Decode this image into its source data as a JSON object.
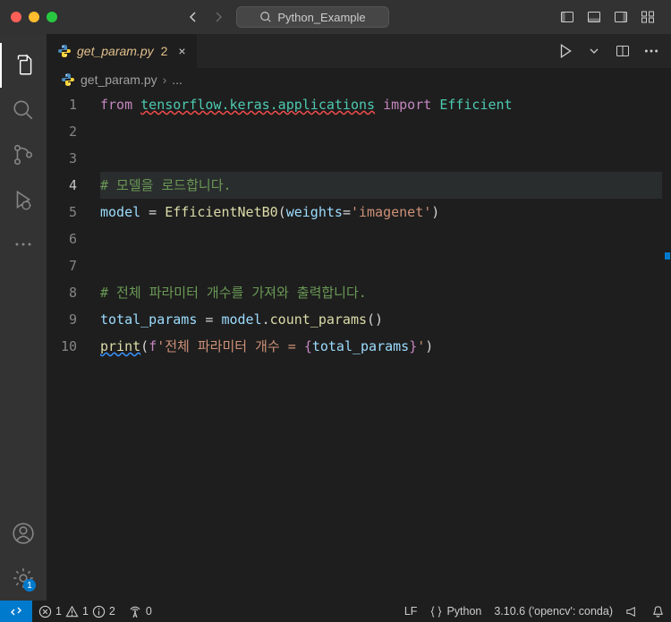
{
  "titlebar": {
    "project_name": "Python_Example"
  },
  "tab": {
    "filename": "get_param.py",
    "badge_count": "2",
    "close_symbol": "×"
  },
  "tab_actions": {
    "run": "▷",
    "more": "⋯"
  },
  "breadcrumb": {
    "file": "get_param.py",
    "separator": "›",
    "ellipsis": "..."
  },
  "activity_badge": {
    "settings": "1"
  },
  "code": {
    "lines": [
      {
        "num": "1"
      },
      {
        "num": "2"
      },
      {
        "num": "3"
      },
      {
        "num": "4"
      },
      {
        "num": "5"
      },
      {
        "num": "6"
      },
      {
        "num": "7"
      },
      {
        "num": "8"
      },
      {
        "num": "9"
      },
      {
        "num": "10"
      }
    ],
    "l1_from": "from",
    "l1_mod": "tensorflow.keras.applications",
    "l1_import": "import",
    "l1_cls": "Efficient",
    "l4_comment": "# 모델을 로드합니다.",
    "l5_var": "model",
    "l5_eq": " = ",
    "l5_fn": "EfficientNetB0",
    "l5_p1": "(",
    "l5_argn": "weights",
    "l5_eq2": "=",
    "l5_str": "'imagenet'",
    "l5_p2": ")",
    "l8_comment": "# 전체 파라미터 개수를 가져와 출력합니다.",
    "l9_var": "total_params",
    "l9_eq": " = ",
    "l9_obj": "model",
    "l9_dot": ".",
    "l9_fn": "count_params",
    "l9_pp": "()",
    "l10_fn": "print",
    "l10_p1": "(",
    "l10_f": "f",
    "l10_str1": "'전체 파라미터 개수 = ",
    "l10_br1": "{",
    "l10_var": "total_params",
    "l10_br2": "}",
    "l10_str2": "'",
    "l10_p2": ")"
  },
  "status": {
    "errors": "1",
    "warnings": "1",
    "info": "2",
    "radio": "0",
    "lf": "LF",
    "lang": "Python",
    "interpreter": "3.10.6 ('opencv': conda)"
  }
}
